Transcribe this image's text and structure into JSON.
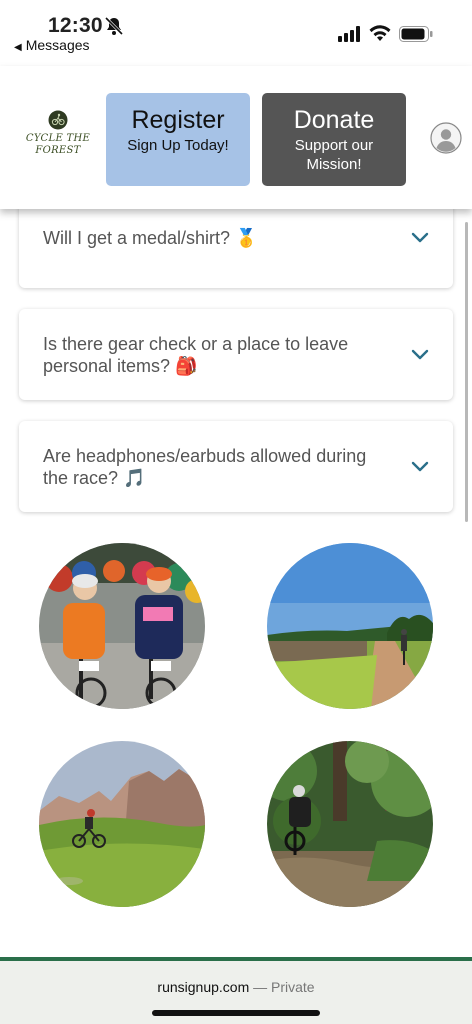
{
  "status_bar": {
    "time": "12:30",
    "back_label": "Messages",
    "icons": [
      "bell-slash-icon",
      "cellular-signal-icon",
      "wifi-icon",
      "battery-icon"
    ]
  },
  "header": {
    "logo_line1": "CYCLE THE",
    "logo_line2": "FOREST",
    "register_title": "Register",
    "register_sub": "Sign Up Today!",
    "donate_title": "Donate",
    "donate_sub": "Support our Mission!",
    "account_icon": "user-avatar-icon",
    "colors": {
      "register_bg": "#a6c2e6",
      "donate_bg": "#555555",
      "logo_green": "#3a4d22"
    }
  },
  "faq": [
    {
      "question": "Will I get a medal/shirt? 🥇"
    },
    {
      "question": "Is there gear check or a place to leave personal items? 🎒"
    },
    {
      "question": "Are headphones/earbuds allowed during the race? 🎵"
    }
  ],
  "photos": [
    {
      "name": "photo-riders-start-line"
    },
    {
      "name": "photo-rider-dirt-road"
    },
    {
      "name": "photo-rider-mountain-meadow"
    },
    {
      "name": "photo-rider-forest-trail"
    }
  ],
  "browser_bar": {
    "domain": "runsignup.com",
    "separator": " — ",
    "privacy": "Private",
    "accent": "#2a6f4a"
  }
}
